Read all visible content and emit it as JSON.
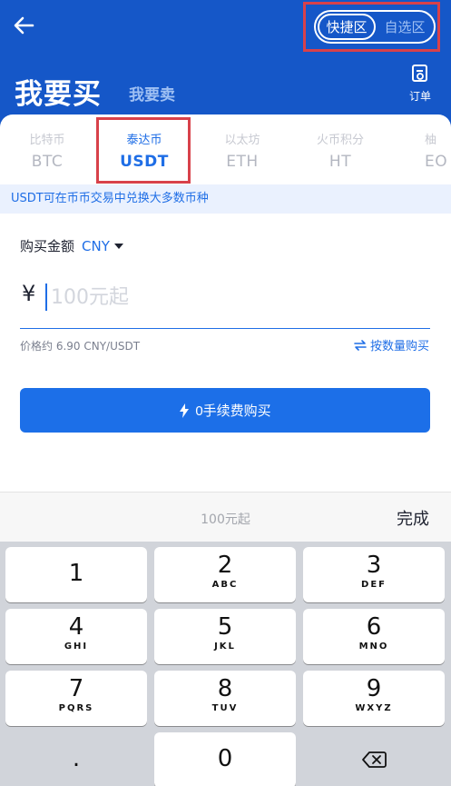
{
  "header": {
    "segment": {
      "active": "快捷区",
      "inactive": "自选区"
    },
    "title": "我要买",
    "secondary_title": "我要卖",
    "order_label": "订单",
    "colors": {
      "header_bg": "#1557c8",
      "accent": "#1f6ee6",
      "highlight_outline": "#d8414a"
    }
  },
  "tabs": [
    {
      "cn": "比特币",
      "en": "BTC",
      "active": false
    },
    {
      "cn": "泰达币",
      "en": "USDT",
      "active": true
    },
    {
      "cn": "以太坊",
      "en": "ETH",
      "active": false
    },
    {
      "cn": "火币积分",
      "en": "HT",
      "active": false
    },
    {
      "cn": "柚",
      "en": "EO",
      "active": false
    }
  ],
  "notice": "USDT可在币币交易中兑换大多数币种",
  "form": {
    "amount_label": "购买金额",
    "currency": "CNY",
    "currency_symbol": "¥",
    "placeholder": "100元起",
    "price_text": "价格约 6.90 CNY/USDT",
    "switch_text": "按数量购买",
    "buy_button": "0手续费购买"
  },
  "keyboard": {
    "hint": "100元起",
    "done": "完成",
    "keys": [
      {
        "num": "1",
        "sub": ""
      },
      {
        "num": "2",
        "sub": "ABC"
      },
      {
        "num": "3",
        "sub": "DEF"
      },
      {
        "num": "4",
        "sub": "GHI"
      },
      {
        "num": "5",
        "sub": "JKL"
      },
      {
        "num": "6",
        "sub": "MNO"
      },
      {
        "num": "7",
        "sub": "PQRS"
      },
      {
        "num": "8",
        "sub": "TUV"
      },
      {
        "num": "9",
        "sub": "WXYZ"
      },
      {
        "num": ".",
        "sub": ""
      },
      {
        "num": "0",
        "sub": ""
      }
    ],
    "delete_icon": "backspace-icon"
  }
}
